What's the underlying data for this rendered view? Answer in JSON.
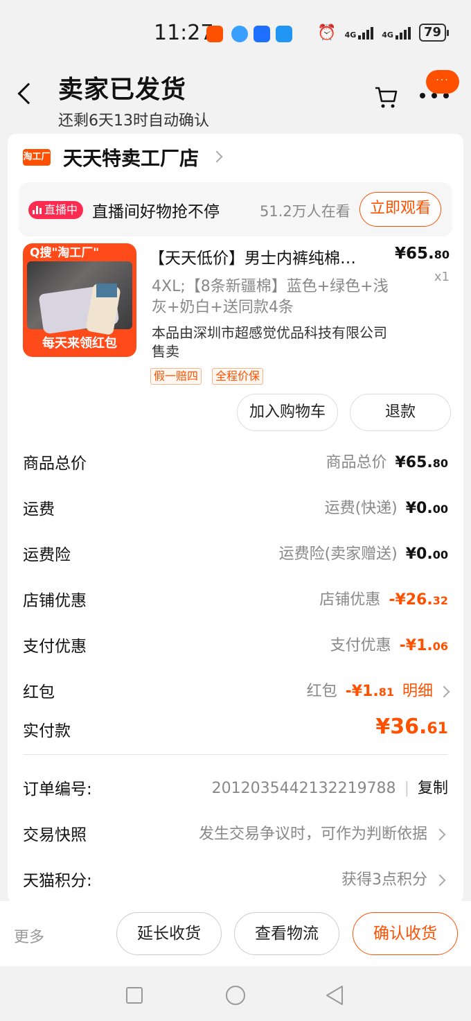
{
  "status_bar": {
    "time": "11:27",
    "network1": "4G",
    "network2": "4G",
    "battery": "79"
  },
  "header": {
    "title": "卖家已发货",
    "subtitle": "还剩6天13时自动确认",
    "badge": "···"
  },
  "shop": {
    "logo_text": "淘工厂",
    "name": "天天特卖工厂店"
  },
  "live": {
    "tag": "直播中",
    "text": "直播间好物抢不停",
    "viewers": "51.2万人在看",
    "button": "立即观看"
  },
  "product": {
    "thumb_top": "Q搜\"淘工厂\"",
    "thumb_bottom": "每天来领红包",
    "title": "【天天低价】男士内裤纯棉…",
    "price_main": "¥65.",
    "price_cents": "80",
    "qty": "x1",
    "sku": "4XL;【8条新疆棉】蓝色+绿色+浅灰+奶白+送同款4条",
    "seller": "本品由深圳市超感觉优品科技有限公司售卖",
    "tags": [
      "假一赔四",
      "全程价保"
    ],
    "buttons": {
      "add_cart": "加入购物车",
      "refund": "退款"
    }
  },
  "summary": [
    {
      "label": "商品总价",
      "desc": "商品总价",
      "main": "¥65.",
      "cents": "80",
      "red": false
    },
    {
      "label": "运费",
      "desc": "运费(快递)",
      "main": "¥0.",
      "cents": "00",
      "red": false
    },
    {
      "label": "运费险",
      "desc": "运费险(卖家赠送)",
      "main": "¥0.",
      "cents": "00",
      "red": false
    },
    {
      "label": "店铺优惠",
      "desc": "店铺优惠",
      "main": "-¥26.",
      "cents": "32",
      "red": true
    },
    {
      "label": "支付优惠",
      "desc": "支付优惠",
      "main": "-¥1.",
      "cents": "06",
      "red": true
    },
    {
      "label": "红包",
      "desc": "红包",
      "main": "-¥1.",
      "cents": "81",
      "red": true,
      "link": "明细"
    }
  ],
  "paid": {
    "label": "实付款",
    "main": "¥36.",
    "cents": "61"
  },
  "order_info": {
    "order_no_label": "订单编号:",
    "order_no": "2012035442132219788",
    "copy": "复制",
    "snapshot_label": "交易快照",
    "snapshot_value": "发生交易争议时，可作为判断依据",
    "points_label": "天猫积分:",
    "points_value": "获得3点积分"
  },
  "actions": {
    "more": "更多",
    "extend": "延长收货",
    "logistics": "查看物流",
    "confirm": "确认收货"
  },
  "colors": {
    "accent": "#ff5000",
    "live_tag": "#ff2a4f"
  }
}
